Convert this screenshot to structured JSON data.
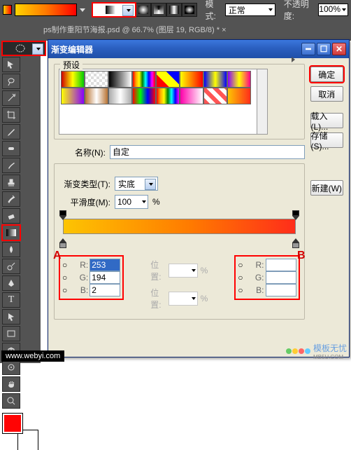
{
  "options": {
    "mode_label": "模式:",
    "mode_value": "正常",
    "opacity_label": "不透明度:",
    "opacity_value": "100%"
  },
  "tab": "ps制作重阳节海报.psd @ 66.7% (图层 19, RGB/8) * ×",
  "dialog": {
    "title": "渐变编辑器",
    "presets_label": "预设",
    "buttons": {
      "ok": "确定",
      "cancel": "取消",
      "load": "载入(L)...",
      "save": "存储(S)...",
      "new": "新建(W)"
    },
    "name_label": "名称(N):",
    "name_value": "自定",
    "type_label": "渐变类型(T):",
    "type_value": "实底",
    "smooth_label": "平滑度(M):",
    "smooth_value": "100",
    "pct": "%",
    "markerA": "A",
    "markerB": "B",
    "loc_label": "位置:",
    "a": {
      "r": "253",
      "g": "194",
      "b": "2"
    },
    "b": "B:",
    "radio": "○",
    "r": "R:",
    "g": "G:"
  },
  "watermark": "www.webyi.com",
  "watermark2": "模板无忧",
  "watermark3": "MB5U.COM"
}
